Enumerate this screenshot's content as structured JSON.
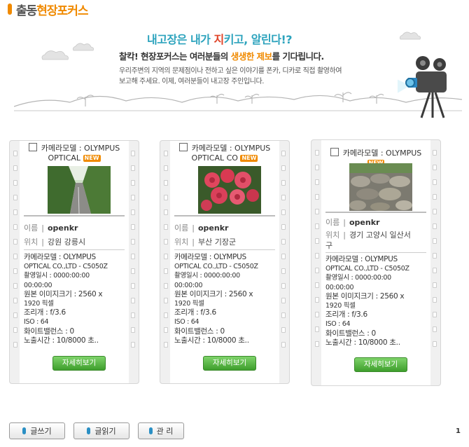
{
  "header": {
    "title_part1": "출동",
    "title_part2": "현장포커스"
  },
  "banner": {
    "slogan_1": "내고장은 내가 ",
    "slogan_2": "지",
    "slogan_3": "키고, 알린다!?",
    "sub_1": "찰칵! 현장포커스는 여러분들의 ",
    "sub_hl": "생생한 제보",
    "sub_2": "를 기다립니다.",
    "desc_1": "우리주변의 지역의 문제점이나 전하고 싶은 이야기를 폰카, 디카로 직접 촬영하여",
    "desc_2": "보고해 주세요. 이제, 여러분들이 내고장 주인입니다."
  },
  "colors": {
    "accent": "#f08a00",
    "slogan": "#2ca3bd",
    "button_green": "#4caf3a"
  },
  "cards": [
    {
      "caption_1": "카메라모델 : OLYMPUS",
      "caption_2": "OPTICAL",
      "new_badge": "NEW",
      "name_label": "이름",
      "name": "openkr",
      "loc_label": "위치",
      "location": "강원 강릉시",
      "meta": [
        "카메라모델 : OLYMPUS",
        "OPTICAL CO.,LTD - C5050Z",
        "촬영일시 : 0000:00:00",
        "00:00:00",
        "원본 이미지크기 : 2560 x",
        "1920 픽셀",
        "조리개 : f/3.6",
        "ISO : 64",
        "화이트밸런스 : 0",
        "노출시간 : 10/8000 초.."
      ],
      "detail_label": "자세히보기"
    },
    {
      "caption_1": "카메라모델 : OLYMPUS",
      "caption_2": "OPTICAL CO",
      "new_badge": "NEW",
      "name_label": "이름",
      "name": "openkr",
      "loc_label": "위치",
      "location": "부산 기장군",
      "meta": [
        "카메라모델 : OLYMPUS",
        "OPTICAL CO.,LTD - C5050Z",
        "촬영일시 : 0000:00:00",
        "00:00:00",
        "원본 이미지크기 : 2560 x",
        "1920 픽셀",
        "조리개 : f/3.6",
        "ISO : 64",
        "화이트밸런스 : 0",
        "노출시간 : 10/8000 초.."
      ],
      "detail_label": "자세히보기"
    },
    {
      "caption_1": "카메라모델 : OLYMPUS",
      "new_badge": "NEW",
      "name_label": "이름",
      "name": "openkr",
      "loc_label": "위치",
      "location_1": "경기 고양시 일산서",
      "location_2": "구",
      "meta": [
        "카메라모델 : OLYMPUS",
        "OPTICAL CO.,LTD - C5050Z",
        "촬영일시 : 0000:00:00",
        "00:00:00",
        "원본 이미지크기 : 2560 x",
        "1920 픽셀",
        "조리개 : f/3.6",
        "ISO : 64",
        "화이트밸런스 : 0",
        "노출시간 : 10/8000 초.."
      ],
      "detail_label": "자세히보기"
    }
  ],
  "buttons": {
    "write": "글쓰기",
    "read": "글읽기",
    "admin": "관 리"
  },
  "pagination": {
    "current": "1"
  }
}
